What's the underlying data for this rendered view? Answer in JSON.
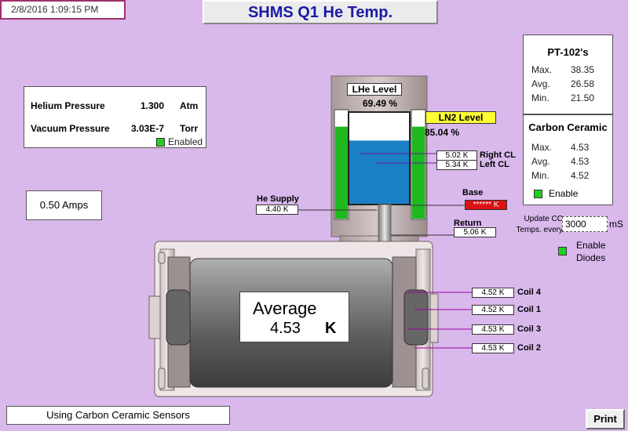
{
  "header": {
    "timestamp": "2/8/2016 1:09:15 PM",
    "title": "SHMS Q1 He Temp."
  },
  "pressure_panel": {
    "helium_label": "Helium Pressure",
    "helium_value": "1.300",
    "helium_unit": "Atm",
    "vacuum_label": "Vacuum Pressure",
    "vacuum_value": "3.03E-7",
    "vacuum_unit": "Torr",
    "enabled_label": "Enabled"
  },
  "current": {
    "amps": "0.50 Amps"
  },
  "pt102": {
    "title": "PT-102's",
    "max_label": "Max.",
    "max_value": "38.35",
    "avg_label": "Avg.",
    "avg_value": "26.58",
    "min_label": "Min.",
    "min_value": "21.50"
  },
  "carbon_ceramic": {
    "title": "Carbon Ceramic",
    "max_label": "Max.",
    "max_value": "4.53",
    "avg_label": "Avg.",
    "avg_value": "4.53",
    "min_label": "Min.",
    "min_value": "4.52",
    "enable_label": "Enable"
  },
  "update": {
    "label_line1": "Update CC",
    "label_line2": "Temps. every",
    "value": "3000",
    "unit": "mS"
  },
  "diodes": {
    "label_line1": "Enable",
    "label_line2": "Diodes"
  },
  "lhe": {
    "label": "LHe Level",
    "value": "69.49 %",
    "level_fraction": 0.6949
  },
  "ln2": {
    "label": "LN2 Level",
    "value": "85.04 %",
    "level_fraction": 0.8504
  },
  "sensors": {
    "right_cl_value": "5.02 K",
    "right_cl_label": "Right CL",
    "left_cl_value": "5.34 K",
    "left_cl_label": "Left CL",
    "he_supply_label": "He Supply",
    "he_supply_value": "4.40 K",
    "base_label": "Base",
    "base_value": "****** K",
    "return_label": "Return",
    "return_value": "5.06 K"
  },
  "coils": [
    {
      "value": "4.52 K",
      "label": "Coil 4"
    },
    {
      "value": "4.52 K",
      "label": "Coil 1"
    },
    {
      "value": "4.53 K",
      "label": "Coil 3"
    },
    {
      "value": "4.53 K",
      "label": "Coil 2"
    }
  ],
  "average": {
    "label": "Average",
    "value": "4.53",
    "unit": "K"
  },
  "footer": {
    "status": "Using Carbon Ceramic Sensors",
    "print_label": "Print"
  },
  "colors": {
    "background": "#d9b8ec",
    "title_text": "#1b1ba6",
    "lhe_fill": "#1a7fc4",
    "ln2_fill": "#1fb81f",
    "alarm": "#dd1111",
    "ln2_label_bg": "#ffff33"
  }
}
